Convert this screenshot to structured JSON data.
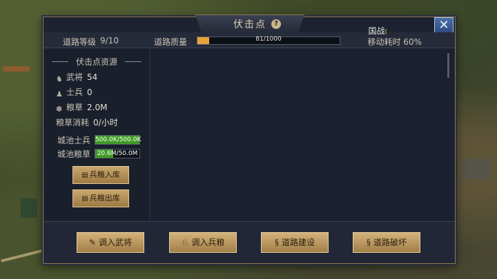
{
  "window": {
    "title": "伏击点",
    "help": "?",
    "close": "✕"
  },
  "header": {
    "road_level_label": "道路等级",
    "road_level_value": "9/10",
    "road_quality_label": "道路质量",
    "road_quality_text": "81/1000",
    "road_quality_fraction": 0.081,
    "national_war": "国战",
    "national_war_badge": "(",
    "move_cost": "移动耗时 60%"
  },
  "resources": {
    "title": "伏击点资源",
    "general": {
      "icon": "general-icon",
      "label": "武将",
      "value": "54"
    },
    "soldier": {
      "icon": "soldier-icon",
      "label": "士兵",
      "value": "0"
    },
    "grain": {
      "icon": "grain-icon",
      "label": "粮草",
      "value": "2.0M"
    },
    "grain_consume": {
      "label": "粮草消耗",
      "value": "0/小时"
    },
    "city_soldier": {
      "label": "城池士兵",
      "text": "500.0K/500.0K",
      "fraction": 1.0
    },
    "city_grain": {
      "label": "城池粮草",
      "text": "20.6M/50.0M",
      "fraction": 0.412
    },
    "deposit_button": "兵粮入库",
    "withdraw_button": "兵粮出库"
  },
  "actions": {
    "transfer_general": "调入武将",
    "transfer_supplies": "调入兵粮",
    "road_build": "道路建设",
    "road_destroy": "道路破坏"
  },
  "colors": {
    "accent_gold": "#c9a76c",
    "bar_green": "#3f9a24",
    "bar_orange": "#e8a23a",
    "close_blue": "#3d5f96"
  }
}
